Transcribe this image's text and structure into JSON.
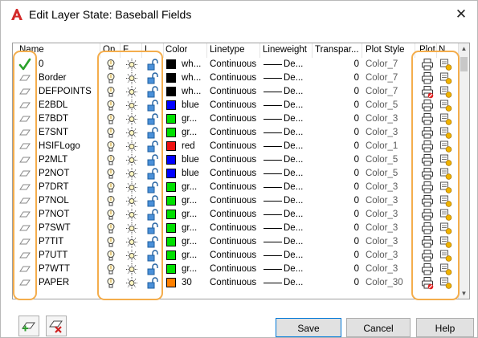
{
  "window": {
    "title": "Edit Layer State: Baseball Fields",
    "close_glyph": "✕"
  },
  "columns": {
    "name": "Name",
    "on": "On",
    "freeze": "F...",
    "lock": "L...",
    "color": "Color",
    "linetype": "Linetype",
    "lineweight": "Lineweight",
    "transparency": "Transpar...",
    "plot_style": "Plot Style",
    "plot": "Plot",
    "new_vp_freeze": "N..."
  },
  "layers": [
    {
      "name": "0",
      "current": true,
      "color_name": "wh...",
      "color_hex": "#000000",
      "linetype": "Continuous",
      "lineweight": "De...",
      "transparency": "0",
      "plot_style": "Color_7",
      "plot": true
    },
    {
      "name": "Border",
      "current": false,
      "color_name": "wh...",
      "color_hex": "#000000",
      "linetype": "Continuous",
      "lineweight": "De...",
      "transparency": "0",
      "plot_style": "Color_7",
      "plot": true
    },
    {
      "name": "DEFPOINTS",
      "current": false,
      "color_name": "wh...",
      "color_hex": "#000000",
      "linetype": "Continuous",
      "lineweight": "De...",
      "transparency": "0",
      "plot_style": "Color_7",
      "plot": false
    },
    {
      "name": "E2BDL",
      "current": false,
      "color_name": "blue",
      "color_hex": "#0000ff",
      "linetype": "Continuous",
      "lineweight": "De...",
      "transparency": "0",
      "plot_style": "Color_5",
      "plot": true
    },
    {
      "name": "E7BDT",
      "current": false,
      "color_name": "gr...",
      "color_hex": "#00e000",
      "linetype": "Continuous",
      "lineweight": "De...",
      "transparency": "0",
      "plot_style": "Color_3",
      "plot": true
    },
    {
      "name": "E7SNT",
      "current": false,
      "color_name": "gr...",
      "color_hex": "#00e000",
      "linetype": "Continuous",
      "lineweight": "De...",
      "transparency": "0",
      "plot_style": "Color_3",
      "plot": true
    },
    {
      "name": "HSIFLogo",
      "current": false,
      "color_name": "red",
      "color_hex": "#ee1111",
      "linetype": "Continuous",
      "lineweight": "De...",
      "transparency": "0",
      "plot_style": "Color_1",
      "plot": true
    },
    {
      "name": "P2MLT",
      "current": false,
      "color_name": "blue",
      "color_hex": "#0000ff",
      "linetype": "Continuous",
      "lineweight": "De...",
      "transparency": "0",
      "plot_style": "Color_5",
      "plot": true
    },
    {
      "name": "P2NOT",
      "current": false,
      "color_name": "blue",
      "color_hex": "#0000ff",
      "linetype": "Continuous",
      "lineweight": "De...",
      "transparency": "0",
      "plot_style": "Color_5",
      "plot": true
    },
    {
      "name": "P7DRT",
      "current": false,
      "color_name": "gr...",
      "color_hex": "#00e000",
      "linetype": "Continuous",
      "lineweight": "De...",
      "transparency": "0",
      "plot_style": "Color_3",
      "plot": true
    },
    {
      "name": "P7NOL",
      "current": false,
      "color_name": "gr...",
      "color_hex": "#00e000",
      "linetype": "Continuous",
      "lineweight": "De...",
      "transparency": "0",
      "plot_style": "Color_3",
      "plot": true
    },
    {
      "name": "P7NOT",
      "current": false,
      "color_name": "gr...",
      "color_hex": "#00e000",
      "linetype": "Continuous",
      "lineweight": "De...",
      "transparency": "0",
      "plot_style": "Color_3",
      "plot": true
    },
    {
      "name": "P7SWT",
      "current": false,
      "color_name": "gr...",
      "color_hex": "#00e000",
      "linetype": "Continuous",
      "lineweight": "De...",
      "transparency": "0",
      "plot_style": "Color_3",
      "plot": true
    },
    {
      "name": "P7TIT",
      "current": false,
      "color_name": "gr...",
      "color_hex": "#00e000",
      "linetype": "Continuous",
      "lineweight": "De...",
      "transparency": "0",
      "plot_style": "Color_3",
      "plot": true
    },
    {
      "name": "P7UTT",
      "current": false,
      "color_name": "gr...",
      "color_hex": "#00e000",
      "linetype": "Continuous",
      "lineweight": "De...",
      "transparency": "0",
      "plot_style": "Color_3",
      "plot": true
    },
    {
      "name": "P7WTT",
      "current": false,
      "color_name": "gr...",
      "color_hex": "#00e000",
      "linetype": "Continuous",
      "lineweight": "De...",
      "transparency": "0",
      "plot_style": "Color_3",
      "plot": true
    },
    {
      "name": "PAPER",
      "current": false,
      "color_name": "30",
      "color_hex": "#ff8000",
      "linetype": "Continuous",
      "lineweight": "De...",
      "transparency": "0",
      "plot_style": "Color_30",
      "plot": false
    }
  ],
  "buttons": {
    "save": "Save",
    "cancel": "Cancel",
    "help": "Help"
  },
  "toolbar": {
    "add_icon": "add-layer-icon",
    "remove_icon": "remove-layer-icon"
  },
  "colors": {
    "highlight": "#f4ad4c",
    "accent": "#0078d7"
  }
}
